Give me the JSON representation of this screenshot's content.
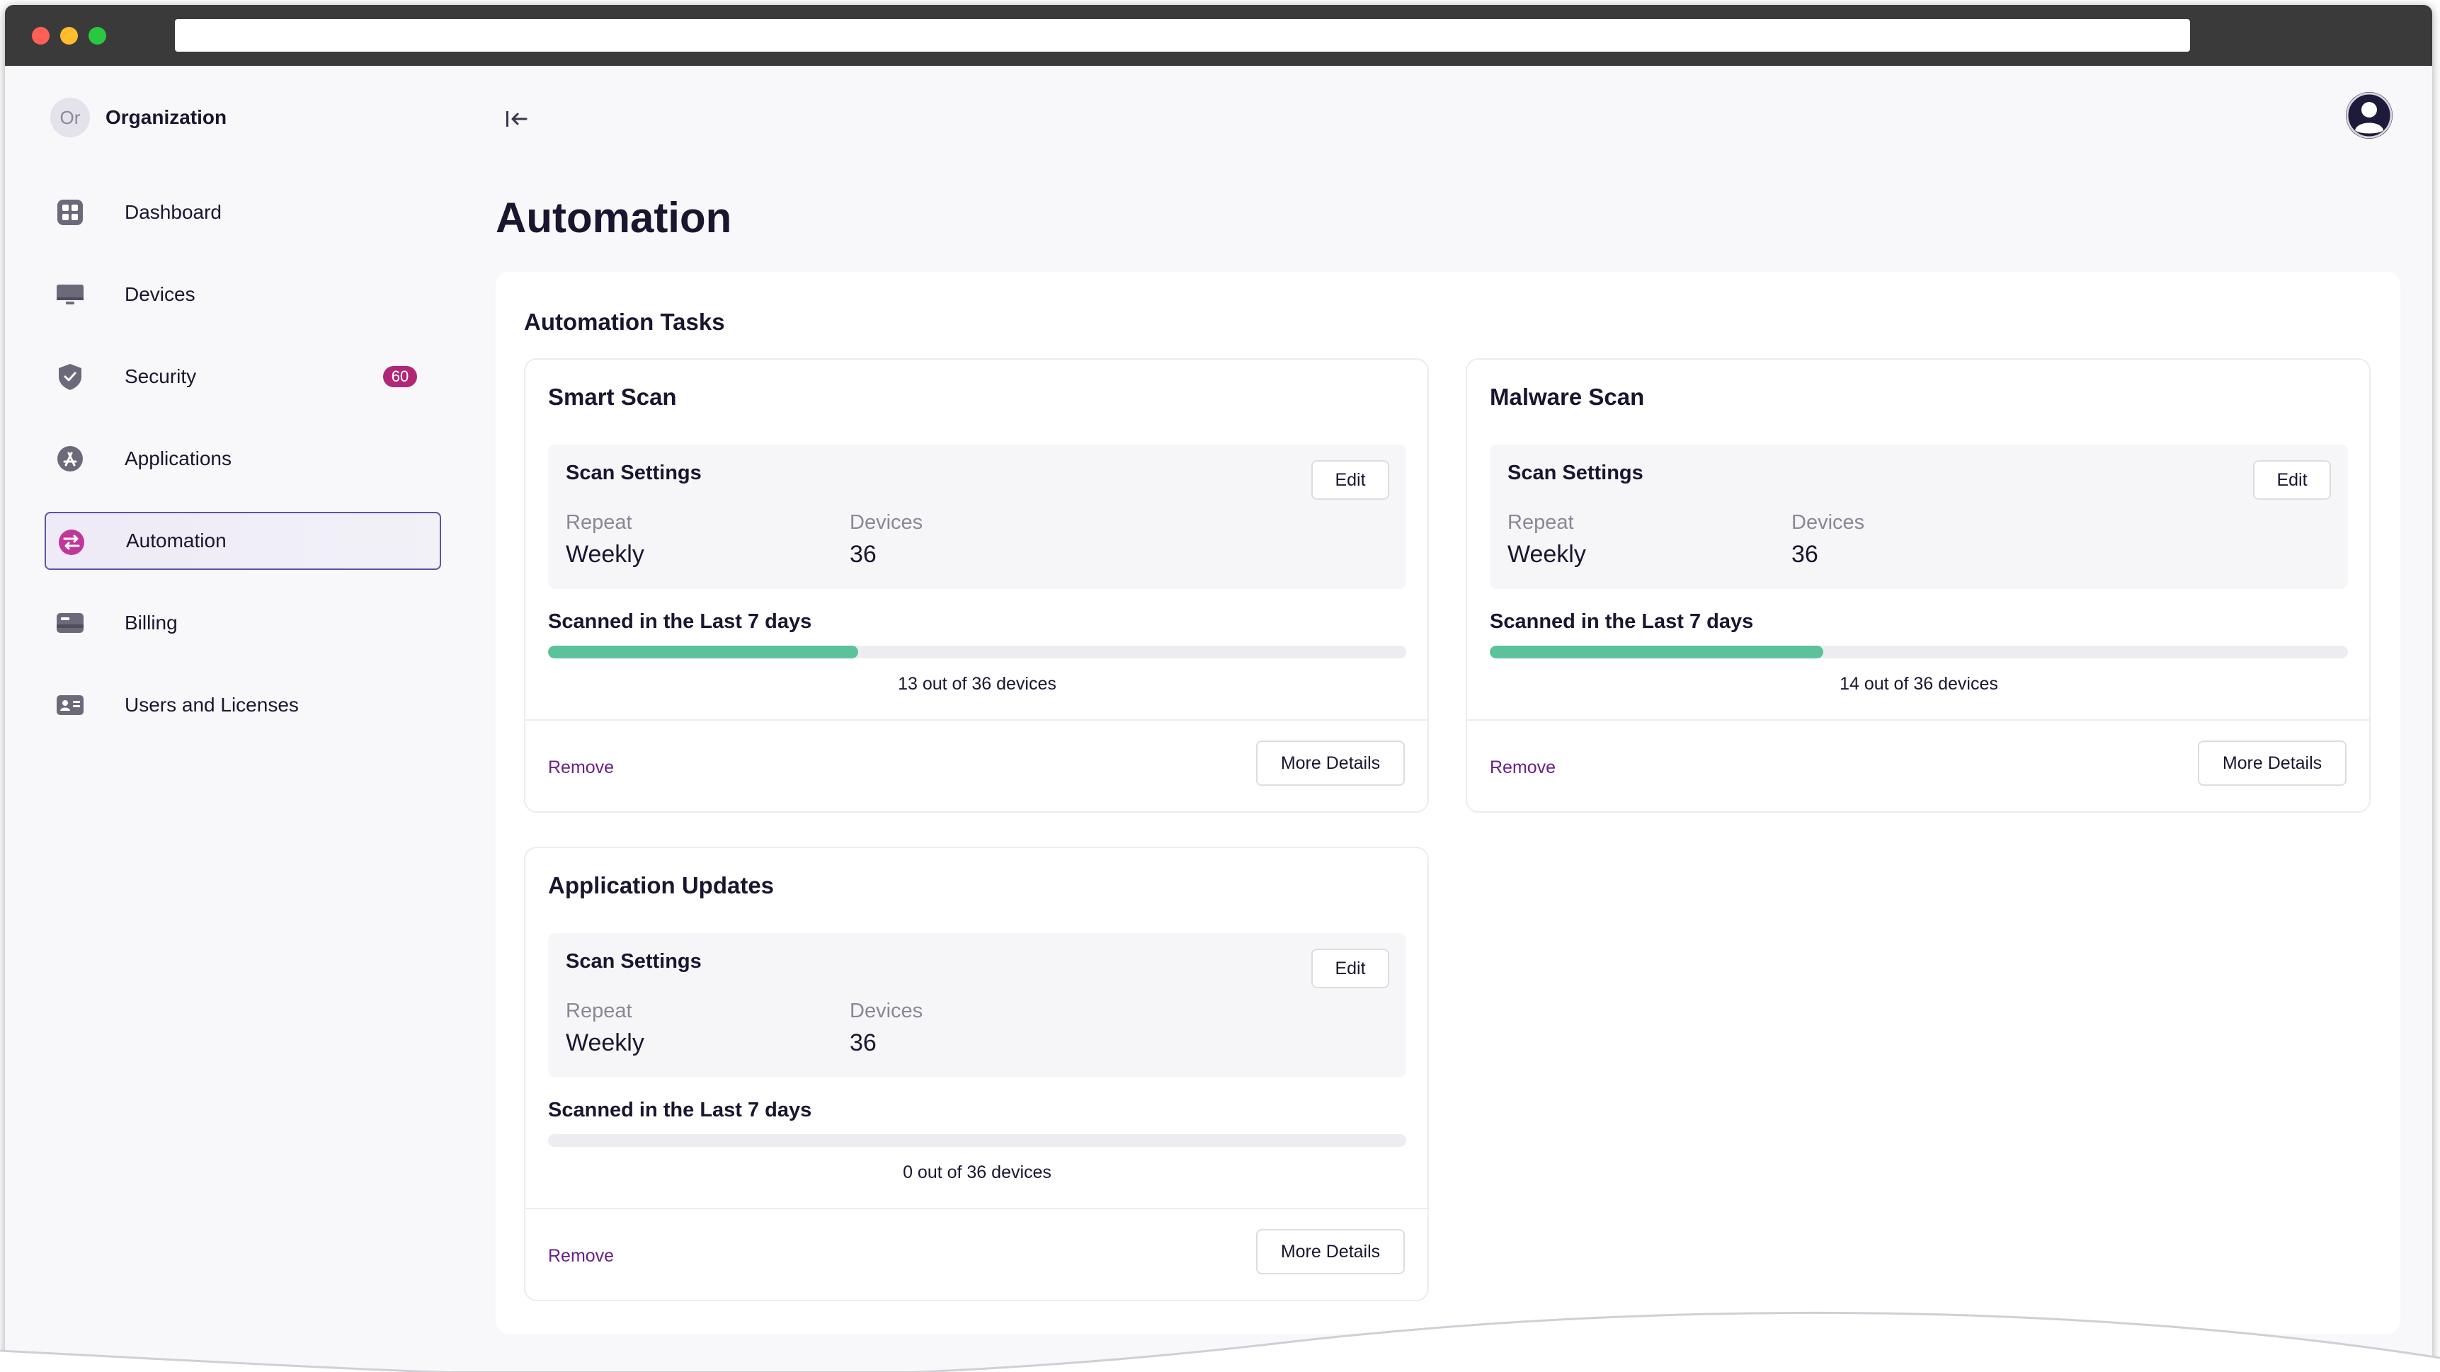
{
  "organization": {
    "avatar_initials": "Or",
    "name": "Organization"
  },
  "sidebar": {
    "items": [
      {
        "label": "Dashboard",
        "icon": "dashboard-icon"
      },
      {
        "label": "Devices",
        "icon": "monitor-icon"
      },
      {
        "label": "Security",
        "icon": "shield-icon",
        "badge": "60"
      },
      {
        "label": "Applications",
        "icon": "app-store-icon"
      },
      {
        "label": "Automation",
        "icon": "automation-icon",
        "active": true
      },
      {
        "label": "Billing",
        "icon": "billing-icon"
      },
      {
        "label": "Users and Licenses",
        "icon": "id-card-icon"
      }
    ]
  },
  "page": {
    "title": "Automation",
    "section_title": "Automation Tasks"
  },
  "tasks": [
    {
      "title": "Smart Scan",
      "settings_title": "Scan Settings",
      "edit_label": "Edit",
      "repeat_label": "Repeat",
      "repeat_value": "Weekly",
      "devices_label": "Devices",
      "devices_value": "36",
      "scanned_label": "Scanned in the Last 7 days",
      "scanned_fraction": 0.361,
      "progress_text": "13 out of 36 devices",
      "remove_label": "Remove",
      "details_label": "More Details"
    },
    {
      "title": "Malware Scan",
      "settings_title": "Scan Settings",
      "edit_label": "Edit",
      "repeat_label": "Repeat",
      "repeat_value": "Weekly",
      "devices_label": "Devices",
      "devices_value": "36",
      "scanned_label": "Scanned in the Last 7 days",
      "scanned_fraction": 0.389,
      "progress_text": "14 out of 36 devices",
      "remove_label": "Remove",
      "details_label": "More Details"
    },
    {
      "title": "Application Updates",
      "settings_title": "Scan Settings",
      "edit_label": "Edit",
      "repeat_label": "Repeat",
      "repeat_value": "Weekly",
      "devices_label": "Devices",
      "devices_value": "36",
      "scanned_label": "Scanned in the Last 7 days",
      "scanned_fraction": 0,
      "progress_text": "0 out of 36 devices",
      "remove_label": "Remove",
      "details_label": "More Details"
    }
  ],
  "colors": {
    "accent": "#5b54a6",
    "badge": "#b02776",
    "progress": "#5cc29b",
    "remove_link": "#6a1f86"
  }
}
